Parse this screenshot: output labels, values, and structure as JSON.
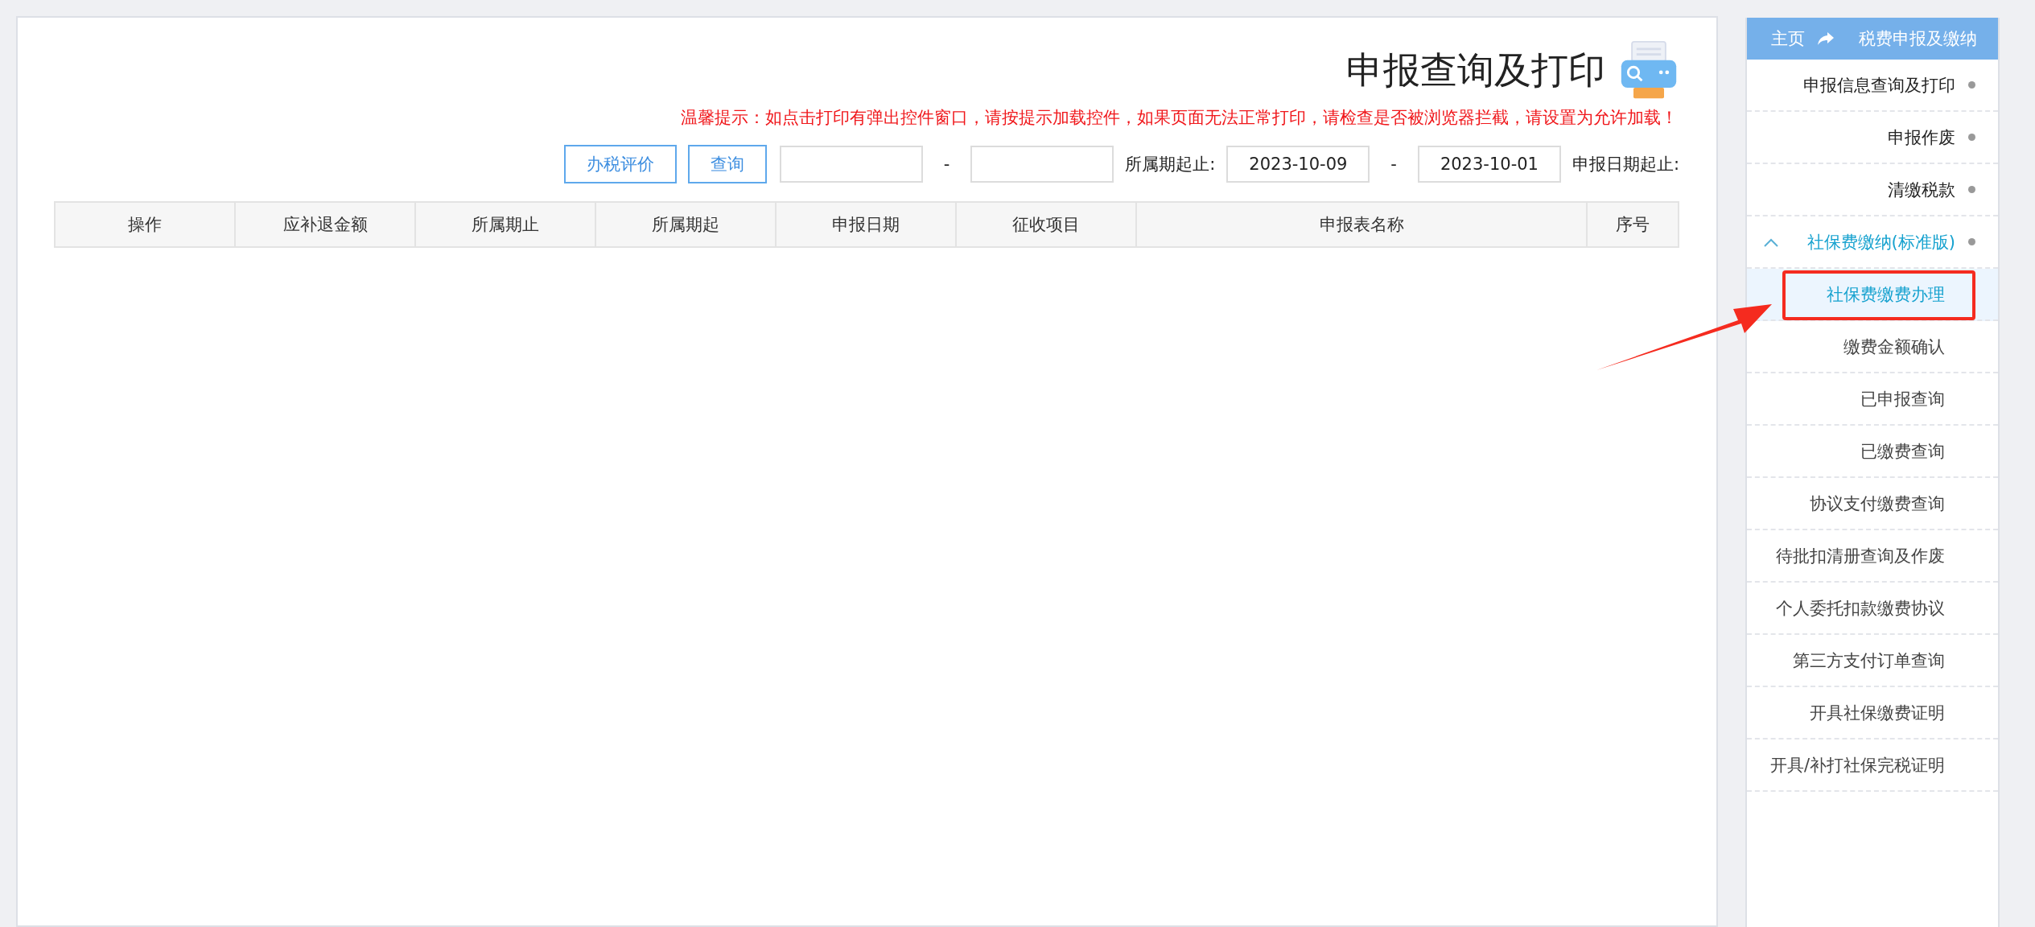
{
  "sidebar": {
    "title": "税费申报及缴纳",
    "home_link": "主页",
    "items": [
      {
        "label": "申报信息查询及打印",
        "expanded": false
      },
      {
        "label": "申报作废",
        "expanded": false
      },
      {
        "label": "清缴税款",
        "expanded": false
      },
      {
        "label": "社保费缴纳(标准版)",
        "expanded": true,
        "children": [
          {
            "label": "社保费缴费办理",
            "selected": true
          },
          {
            "label": "缴费金额确认",
            "selected": false
          },
          {
            "label": "已申报查询",
            "selected": false
          },
          {
            "label": "已缴费查询",
            "selected": false
          },
          {
            "label": "协议支付缴费查询",
            "selected": false
          },
          {
            "label": "待批扣清册查询及作废",
            "selected": false
          },
          {
            "label": "个人委托扣款缴费协议",
            "selected": false
          },
          {
            "label": "第三方支付订单查询",
            "selected": false
          },
          {
            "label": "开具社保缴费证明",
            "selected": false
          },
          {
            "label": "开具/补打社保完税证明",
            "selected": false
          }
        ]
      }
    ]
  },
  "page": {
    "title": "申报查询及打印",
    "notice": "温馨提示：如点击打印有弹出控件窗口，请按提示加载控件，如果页面无法正常打印，请检查是否被浏览器拦截，请设置为允许加载！",
    "buttons": [
      "办税评价",
      "查询"
    ],
    "filters": [
      {
        "label": "所属期起止:"
      },
      {
        "label": "申报日期起止:",
        "from": "2023-10-01",
        "to": "2023-10-09"
      }
    ],
    "separator": "-",
    "table": {
      "columns": [
        "操作",
        "应补退金额",
        "所属期止",
        "所属期起",
        "申报日期",
        "征收项目",
        "申报表名称",
        "序号"
      ]
    }
  }
}
